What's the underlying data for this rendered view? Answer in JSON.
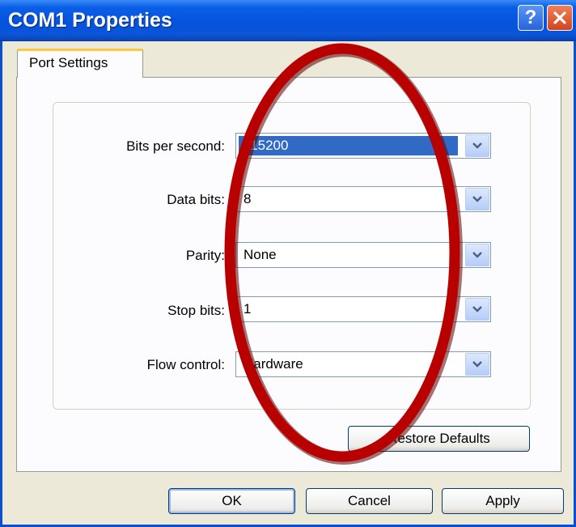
{
  "window": {
    "title": "COM1 Properties"
  },
  "title_buttons": {
    "help_glyph": "?",
    "close_icon": "close-icon"
  },
  "tabs": [
    {
      "label": "Port Settings"
    }
  ],
  "fields": [
    {
      "label": "Bits per second:",
      "value": "115200",
      "selected": true
    },
    {
      "label": "Data bits:",
      "value": "8",
      "selected": false
    },
    {
      "label": "Parity:",
      "value": "None",
      "selected": false
    },
    {
      "label": "Stop bits:",
      "value": "1",
      "selected": false
    },
    {
      "label": "Flow control:",
      "value": "Hardware",
      "selected": false
    }
  ],
  "buttons": {
    "restore": "Restore Defaults",
    "ok": "OK",
    "cancel": "Cancel",
    "apply": "Apply"
  },
  "annotation": {
    "shape": "ellipse",
    "color": "#b80000"
  },
  "colors": {
    "titlebar": "#0553dd",
    "selection": "#316ac5",
    "tab_highlight": "#ffc73c"
  }
}
